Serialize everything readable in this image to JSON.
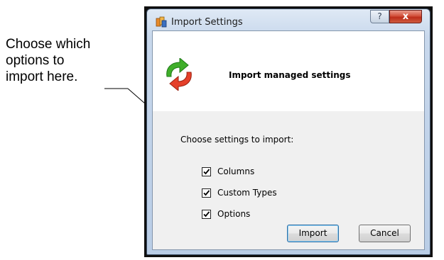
{
  "annotation": {
    "text": "Choose which\noptions to\nimport here."
  },
  "window": {
    "title": "Import Settings",
    "help_label": "?",
    "close_label": "x"
  },
  "header": {
    "title": "Import managed settings"
  },
  "settings": {
    "label": "Choose settings to import:",
    "options": [
      {
        "label": "Columns",
        "checked": true
      },
      {
        "label": "Custom Types",
        "checked": true
      },
      {
        "label": "Options",
        "checked": true
      }
    ]
  },
  "buttons": {
    "import_label": "Import",
    "cancel_label": "Cancel"
  },
  "colors": {
    "arrow_green": "#3fae2a",
    "arrow_red": "#e5402a",
    "close_red": "#c8412c"
  },
  "icons": {
    "app": "app-icon",
    "sync": "sync-arrows-icon",
    "check": "checkmark-icon"
  }
}
